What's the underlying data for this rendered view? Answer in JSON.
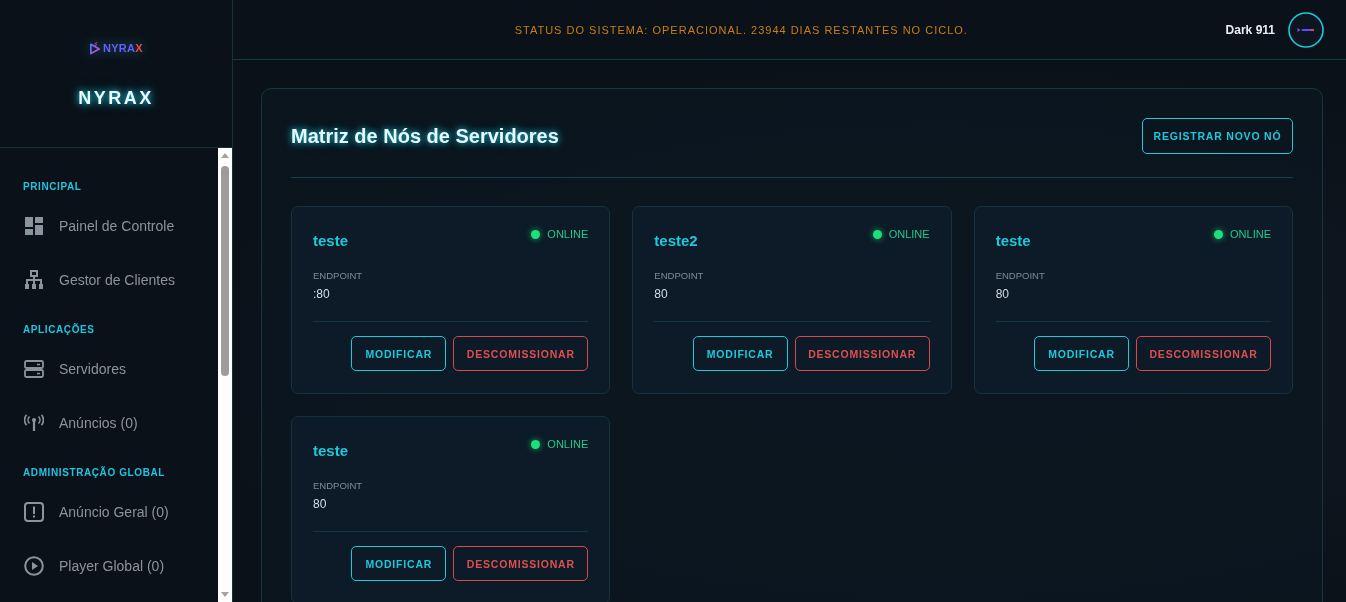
{
  "sidebar": {
    "logo": {
      "main": "NYRA",
      "accent": "X"
    },
    "brand": "NYRAX",
    "sections": [
      {
        "title": "PRINCIPAL",
        "items": [
          {
            "label": "Painel de Controle",
            "kind": "dashboard"
          },
          {
            "label": "Gestor de Clientes",
            "kind": "clients"
          }
        ]
      },
      {
        "title": "APLICAÇÕES",
        "items": [
          {
            "label": "Servidores",
            "kind": "servers"
          },
          {
            "label": "Anúncios (0)",
            "kind": "ads"
          }
        ]
      },
      {
        "title": "ADMINISTRAÇÃO GLOBAL",
        "items": [
          {
            "label": "Anúncio Geral (0)",
            "kind": "notice"
          },
          {
            "label": "Player Global (0)",
            "kind": "player"
          }
        ]
      }
    ]
  },
  "topbar": {
    "status": "STATUS DO SISTEMA: OPERACIONAL. 23944 DIAS RESTANTES NO CICLO.",
    "user": "Dark 911"
  },
  "panel": {
    "title": "Matriz de Nós de Servidores",
    "action": "REGISTRAR NOVO NÓ",
    "nodes": [
      {
        "name": "teste",
        "status": "ONLINE",
        "online": true,
        "endpoint_label": "ENDPOINT",
        "endpoint": ":80",
        "actions": [
          {
            "label": "MODIFICAR",
            "kind": "edit"
          },
          {
            "label": "DESCOMISSIONAR",
            "kind": "danger"
          }
        ]
      },
      {
        "name": "teste2",
        "status": "ONLINE",
        "online": true,
        "endpoint_label": "ENDPOINT",
        "endpoint": "80",
        "actions": [
          {
            "label": "MODIFICAR",
            "kind": "edit"
          },
          {
            "label": "DESCOMISSIONAR",
            "kind": "danger"
          }
        ]
      },
      {
        "name": "teste",
        "status": "ONLINE",
        "online": true,
        "endpoint_label": "ENDPOINT",
        "endpoint": "80",
        "actions": [
          {
            "label": "MODIFICAR",
            "kind": "edit"
          },
          {
            "label": "DESCOMISSIONAR",
            "kind": "danger"
          }
        ]
      },
      {
        "name": "teste",
        "status": "ONLINE",
        "online": true,
        "endpoint_label": "ENDPOINT",
        "endpoint": "80",
        "actions": [
          {
            "label": "MODIFICAR",
            "kind": "edit"
          },
          {
            "label": "DESCOMISSIONAR",
            "kind": "danger"
          }
        ]
      }
    ]
  }
}
